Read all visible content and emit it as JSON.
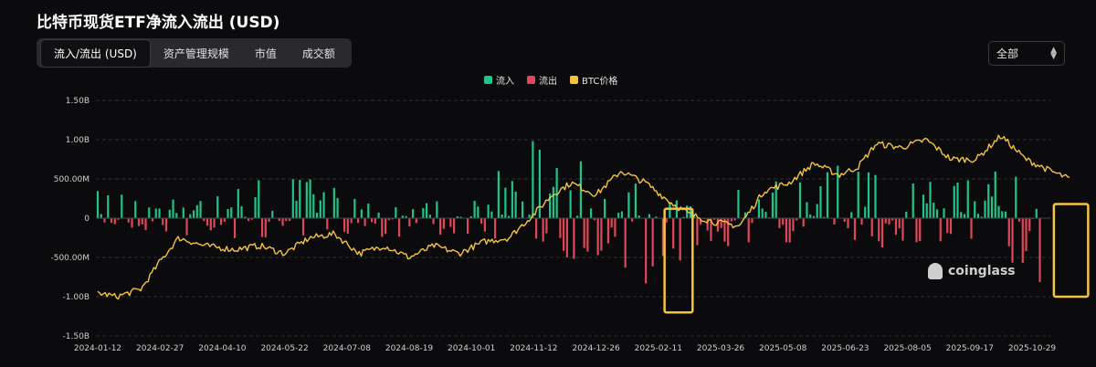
{
  "title": "比特币现货ETF净流入流出 (USD)",
  "tabs": [
    {
      "label": "流入/流出 (USD)",
      "active": true
    },
    {
      "label": "资产管理规模",
      "active": false
    },
    {
      "label": "市值",
      "active": false
    },
    {
      "label": "成交额",
      "active": false
    }
  ],
  "range_select": {
    "value": "全部"
  },
  "watermark": "coinglass",
  "colors": {
    "inflow": "#1ec48a",
    "outflow": "#e0475a",
    "price": "#f5c342",
    "highlight": "#f5c342",
    "grid": "#2c2c30"
  },
  "chart_data": {
    "type": "bar",
    "legend_position": "top-center",
    "grid": true,
    "series": [
      {
        "name": "流入",
        "color": "#1ec48a",
        "kind": "bar"
      },
      {
        "name": "流出",
        "color": "#e0475a",
        "kind": "bar"
      },
      {
        "name": "BTC价格",
        "color": "#f5c342",
        "kind": "line"
      }
    ],
    "y_ticks": [
      "1.50B",
      "1.00B",
      "500.00M",
      "0",
      "-500.00M",
      "-1.00B",
      "-1.50B"
    ],
    "ylim": [
      -1.5,
      1.5
    ],
    "y_unit": "B USD",
    "x_ticks": [
      "2024-01-12",
      "2024-02-27",
      "2024-04-10",
      "2024-05-22",
      "2024-07-08",
      "2024-08-19",
      "2024-10-01",
      "2024-11-12",
      "2024-12-26",
      "2025-02-11",
      "2025-03-26",
      "2025-05-08",
      "2025-06-23",
      "2025-08-05",
      "2025-09-17",
      "2025-10-29"
    ],
    "flow_anchors": [
      {
        "x": 0,
        "in": 0.35,
        "out": -0.12
      },
      {
        "x": 1,
        "in": 0.55,
        "out": -0.18
      },
      {
        "x": 2,
        "in": 0.4,
        "out": -0.3
      },
      {
        "x": 3,
        "in": 0.55,
        "out": -0.25
      },
      {
        "x": 4,
        "in": 0.35,
        "out": -0.2
      },
      {
        "x": 5,
        "in": 0.25,
        "out": -0.25
      },
      {
        "x": 6,
        "in": 0.3,
        "out": -0.2
      },
      {
        "x": 7,
        "in": 1.0,
        "out": -0.35
      },
      {
        "x": 8,
        "in": 0.7,
        "out": -0.6
      },
      {
        "x": 9,
        "in": 0.3,
        "out": -1.0
      },
      {
        "x": 10,
        "in": 0.25,
        "out": -0.4
      },
      {
        "x": 11,
        "in": 0.6,
        "out": -0.3
      },
      {
        "x": 12,
        "in": 0.7,
        "out": -0.4
      },
      {
        "x": 13,
        "in": 0.5,
        "out": -0.35
      },
      {
        "x": 14,
        "in": 0.8,
        "out": -0.45
      },
      {
        "x": 15,
        "in": 0.5,
        "out": -0.9
      }
    ],
    "price_anchors": [
      {
        "x": 0.0,
        "y": -0.95
      },
      {
        "x": 0.3,
        "y": -1.0
      },
      {
        "x": 0.7,
        "y": -0.9
      },
      {
        "x": 1.0,
        "y": -0.55
      },
      {
        "x": 1.3,
        "y": -0.25
      },
      {
        "x": 1.7,
        "y": -0.35
      },
      {
        "x": 2.2,
        "y": -0.4
      },
      {
        "x": 2.6,
        "y": -0.35
      },
      {
        "x": 3.0,
        "y": -0.45
      },
      {
        "x": 3.4,
        "y": -0.25
      },
      {
        "x": 3.8,
        "y": -0.2
      },
      {
        "x": 4.2,
        "y": -0.45
      },
      {
        "x": 4.6,
        "y": -0.35
      },
      {
        "x": 5.0,
        "y": -0.5
      },
      {
        "x": 5.4,
        "y": -0.35
      },
      {
        "x": 5.8,
        "y": -0.45
      },
      {
        "x": 6.2,
        "y": -0.3
      },
      {
        "x": 6.6,
        "y": -0.25
      },
      {
        "x": 7.0,
        "y": 0.05
      },
      {
        "x": 7.3,
        "y": 0.3
      },
      {
        "x": 7.6,
        "y": 0.45
      },
      {
        "x": 8.0,
        "y": 0.3
      },
      {
        "x": 8.4,
        "y": 0.6
      },
      {
        "x": 8.8,
        "y": 0.45
      },
      {
        "x": 9.2,
        "y": 0.2
      },
      {
        "x": 9.5,
        "y": 0.05
      },
      {
        "x": 9.9,
        "y": -0.05
      },
      {
        "x": 10.3,
        "y": -0.1
      },
      {
        "x": 10.7,
        "y": 0.35
      },
      {
        "x": 11.1,
        "y": 0.45
      },
      {
        "x": 11.5,
        "y": 0.7
      },
      {
        "x": 11.9,
        "y": 0.55
      },
      {
        "x": 12.2,
        "y": 0.65
      },
      {
        "x": 12.5,
        "y": 0.95
      },
      {
        "x": 12.9,
        "y": 0.9
      },
      {
        "x": 13.3,
        "y": 1.0
      },
      {
        "x": 13.7,
        "y": 0.75
      },
      {
        "x": 14.1,
        "y": 0.75
      },
      {
        "x": 14.5,
        "y": 1.05
      },
      {
        "x": 14.9,
        "y": 0.75
      },
      {
        "x": 15.3,
        "y": 0.6
      },
      {
        "x": 15.6,
        "y": 0.5
      }
    ],
    "highlights": [
      {
        "from_tick": 9.1,
        "to_tick": 9.55,
        "y_top": 0.12,
        "y_bottom": -1.2
      },
      {
        "from_tick": 15.35,
        "to_tick": 15.9,
        "y_top": 0.18,
        "y_bottom": -1.0
      }
    ]
  }
}
